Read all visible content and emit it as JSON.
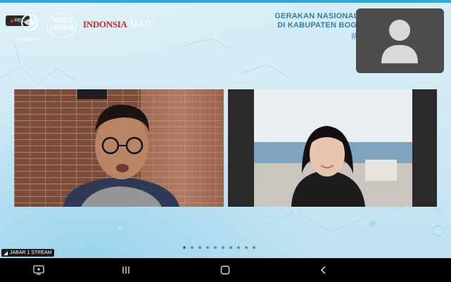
{
  "recording": {
    "label": "REC"
  },
  "logos": {
    "kominfo_label": "KOMINFO",
    "siber_line1": "SIBER",
    "siber_line2": "KREASI",
    "indonesia": "INDONSIA",
    "maju": "MAJU"
  },
  "headline": {
    "line1": "GERAKAN NASIONAL L",
    "line2": "DI KABUPATEN BOGO",
    "hashtag": "#M"
  },
  "stream": {
    "label": "JABAR 1 STREAM"
  },
  "carousel": {
    "count": 10,
    "active": 0
  },
  "colors": {
    "accent": "#2fa7d9",
    "headline": "#2d7fb3",
    "rec_dot": "#e53935",
    "self_tile": "#4c4c4c"
  },
  "navbar": {
    "buttons": [
      "screenshot-icon",
      "recent-apps-icon",
      "home-icon",
      "back-icon"
    ]
  }
}
